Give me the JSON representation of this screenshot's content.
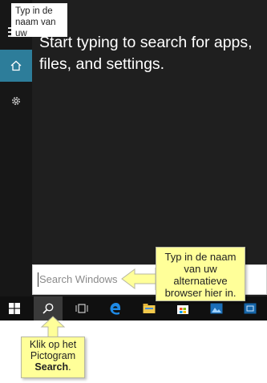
{
  "start_menu": {
    "heading": "Start typing to search for apps, files, and settings."
  },
  "search": {
    "placeholder": "Search Windows"
  },
  "callouts": {
    "top": "Typ in de naam van uw",
    "right": "Typ in de naam van uw alternatieve browser hier in.",
    "bottom_line1": "Klik op het",
    "bottom_line2": "Pictogram",
    "bottom_bold": "Search",
    "bottom_dot": "."
  },
  "colors": {
    "panel": "#1f1f1f",
    "rail": "#171717",
    "accent": "#2d7d9a",
    "taskbar": "#101010",
    "callout": "#ffff99"
  },
  "icons": [
    "hamburger-icon",
    "home-icon",
    "gear-icon",
    "windows-icon",
    "search-icon",
    "task-view-icon",
    "edge-icon",
    "file-explorer-icon",
    "store-icon",
    "photos-icon",
    "media-icon"
  ]
}
